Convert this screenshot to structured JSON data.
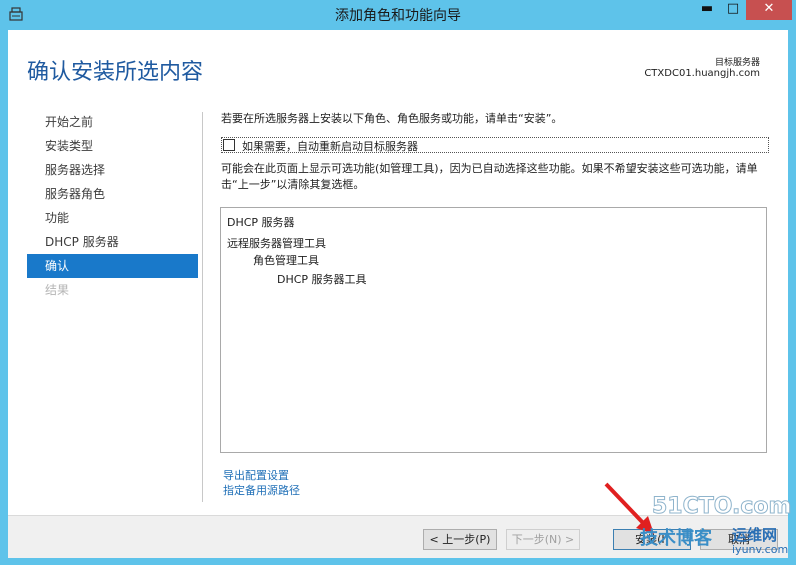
{
  "window": {
    "title": "添加角色和功能向导",
    "controls": {
      "minimize": "▬",
      "maximize": "□",
      "close": "✕"
    }
  },
  "header": {
    "page_title": "确认安装所选内容",
    "destination_label": "目标服务器",
    "destination_server": "CTXDC01.huangjh.com"
  },
  "nav": {
    "items": [
      {
        "label": "开始之前",
        "state": "normal"
      },
      {
        "label": "安装类型",
        "state": "normal"
      },
      {
        "label": "服务器选择",
        "state": "normal"
      },
      {
        "label": "服务器角色",
        "state": "normal"
      },
      {
        "label": "功能",
        "state": "normal"
      },
      {
        "label": "DHCP 服务器",
        "state": "normal"
      },
      {
        "label": "确认",
        "state": "active"
      },
      {
        "label": "结果",
        "state": "disabled"
      }
    ]
  },
  "main": {
    "intro": "若要在所选服务器上安装以下角色、角色服务或功能，请单击“安装”。",
    "restart_checkbox": {
      "label": "如果需要，自动重新启动目标服务器",
      "checked": false
    },
    "optional_note": "可能会在此页面上显示可选功能(如管理工具)，因为已自动选择这些功能。如果不希望安装这些可选功能，请单击“上一步”以清除其复选框。",
    "selections": [
      {
        "text": "DHCP 服务器",
        "level": 0
      },
      {
        "text": "远程服务器管理工具",
        "level": 0
      },
      {
        "text": "角色管理工具",
        "level": 1
      },
      {
        "text": "DHCP 服务器工具",
        "level": 2
      }
    ],
    "links": {
      "export": "导出配置设置",
      "alternate_source": "指定备用源路径"
    }
  },
  "footer": {
    "prev": "< 上一步(P)",
    "next": "下一步(N) >",
    "install": "安装(I)",
    "cancel": "取消"
  },
  "watermark": {
    "top": "51CTO.com",
    "bottom": "技术博客",
    "right": "运维网",
    "url": "iyunv.com"
  },
  "colors": {
    "titlebar": "#5ec3ea",
    "accent": "#1979ca",
    "page_title": "#1f5aa0",
    "link": "#1f6fb7",
    "close_button": "#c75050"
  }
}
